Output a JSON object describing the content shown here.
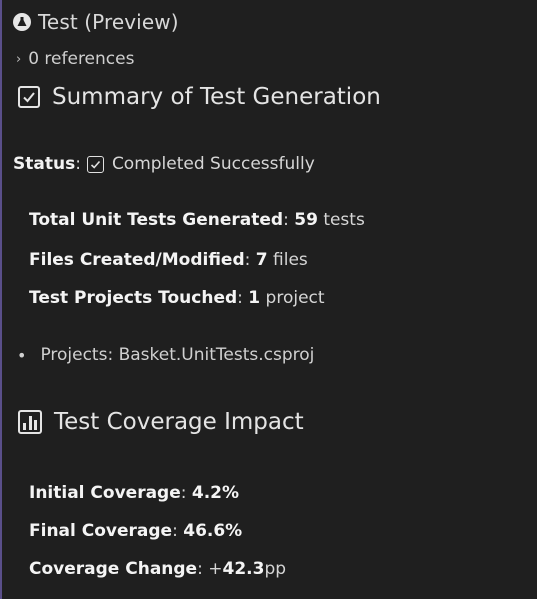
{
  "header": {
    "title": "Test (Preview)",
    "icon": "flask-icon"
  },
  "references": {
    "label": "0 references"
  },
  "summary": {
    "heading": "Summary of Test Generation",
    "status_label": "Status",
    "status_value": "Completed Successfully",
    "stats": [
      {
        "label": "Total Unit Tests Generated",
        "value": "59",
        "unit": "tests"
      },
      {
        "label": "Files Created/Modified",
        "value": "7",
        "unit": "files"
      },
      {
        "label": "Test Projects Touched",
        "value": "1",
        "unit": "project"
      }
    ],
    "projects_line": "Projects: Basket.UnitTests.csproj"
  },
  "coverage": {
    "heading": "Test Coverage Impact",
    "icon": "bar-chart-icon",
    "stats": [
      {
        "label": "Initial Coverage",
        "value": "4.2%",
        "prefix": "",
        "unit": ""
      },
      {
        "label": "Final Coverage",
        "value": "46.6%",
        "prefix": "",
        "unit": ""
      },
      {
        "label": "Coverage Change",
        "value": "42.3",
        "prefix": "+",
        "unit": "pp"
      }
    ]
  },
  "colors": {
    "background": "#1f1f1f",
    "text": "#dcdcdc",
    "accent_rule": "#5a4f8a"
  }
}
